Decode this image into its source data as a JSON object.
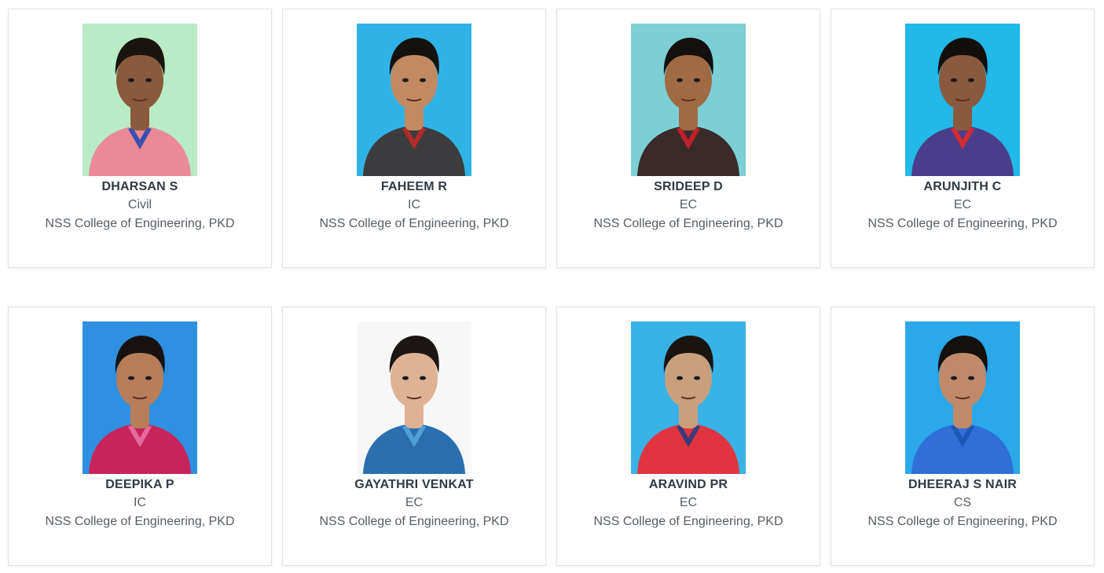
{
  "students": [
    {
      "name": "DHARSAN S",
      "dept": "Civil",
      "college": "NSS College of Engineering, PKD",
      "bg": "#b9ecc4",
      "shirt": "#e98a96",
      "skin": "#8a5a3c",
      "hair": "#1a1410",
      "accent": "#3a4fb0"
    },
    {
      "name": "FAHEEM R",
      "dept": "IC",
      "college": "NSS College of Engineering, PKD",
      "bg": "#2fb3e6",
      "shirt": "#3c3c3e",
      "skin": "#c28a62",
      "hair": "#15110e",
      "accent": "#b22a2a"
    },
    {
      "name": "SRIDEEP D",
      "dept": "EC",
      "college": "NSS College of Engineering, PKD",
      "bg": "#7cd0d4",
      "shirt": "#3a2a2a",
      "skin": "#a06a44",
      "hair": "#141010",
      "accent": "#c0202a"
    },
    {
      "name": "ARUNJITH C",
      "dept": "EC",
      "college": "NSS College of Engineering, PKD",
      "bg": "#22b8e8",
      "shirt": "#4a3e8a",
      "skin": "#8a5a3e",
      "hair": "#120e0c",
      "accent": "#d42a30"
    },
    {
      "name": "DEEPIKA P",
      "dept": "IC",
      "college": "NSS College of Engineering, PKD",
      "bg": "#2f8fe0",
      "shirt": "#c8245c",
      "skin": "#b77d58",
      "hair": "#171210",
      "accent": "#e36a9a"
    },
    {
      "name": "GAYATHRI VENKAT",
      "dept": "EC",
      "college": "NSS College of Engineering, PKD",
      "bg": "#f7f7f7",
      "shirt": "#2a6fae",
      "skin": "#e0b294",
      "hair": "#1c1614",
      "accent": "#4fa0d8"
    },
    {
      "name": "ARAVIND PR",
      "dept": "EC",
      "college": "NSS College of Engineering, PKD",
      "bg": "#39b2e6",
      "shirt": "#e03440",
      "skin": "#caa07c",
      "hair": "#1b1512",
      "accent": "#3b3b7a"
    },
    {
      "name": "DHEERAJ S NAIR",
      "dept": "CS",
      "college": "NSS College of Engineering, PKD",
      "bg": "#2aa8ea",
      "shirt": "#2f6fd6",
      "skin": "#c08a6a",
      "hair": "#14100e",
      "accent": "#1f57b8"
    }
  ]
}
